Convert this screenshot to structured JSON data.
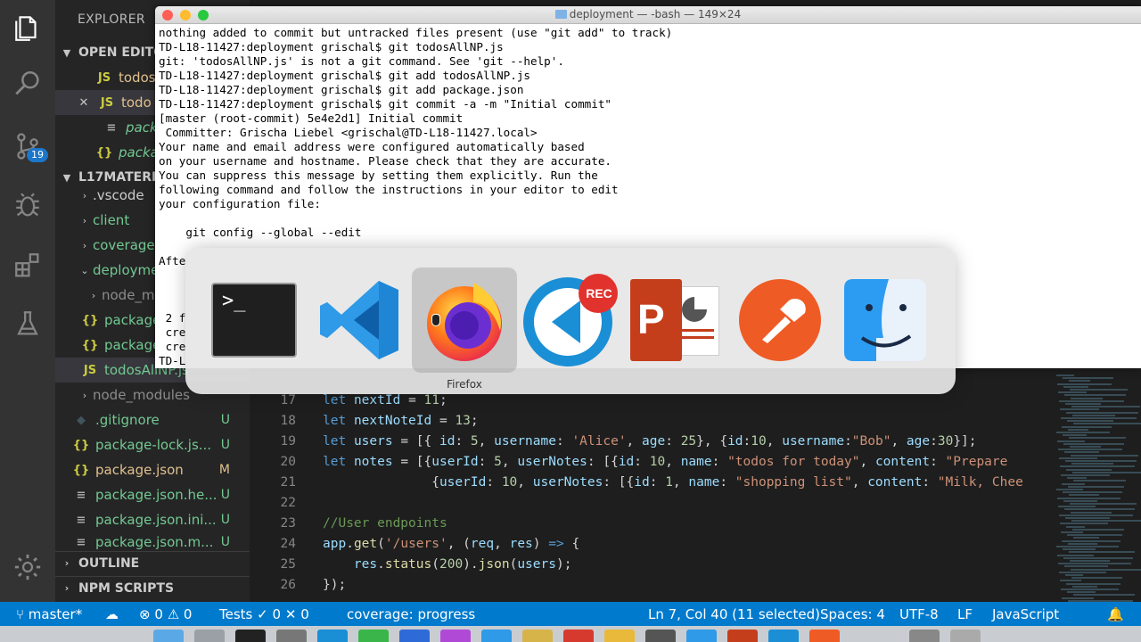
{
  "explorer": {
    "title": "EXPLORER",
    "open_editors_label": "OPEN EDITO",
    "open_editors": [
      {
        "icon": "JS",
        "label": "todos"
      },
      {
        "icon": "JS",
        "label": "todo"
      },
      {
        "icon": "≡",
        "label": "packa"
      },
      {
        "icon": "{}",
        "label": "packa"
      }
    ],
    "close_glyph": "✕",
    "folder_label": "L17MATERIA",
    "tree": [
      {
        "label": ".vscode",
        "status": ""
      },
      {
        "label": "client",
        "status": ""
      },
      {
        "label": "coverage",
        "status": ""
      },
      {
        "label": "deployme",
        "status": ""
      },
      {
        "label": "node_m",
        "status": ""
      },
      {
        "label": "package",
        "status": ""
      },
      {
        "label": "package",
        "status": ""
      },
      {
        "label": "todosAllNP.js",
        "status": ""
      },
      {
        "label": "node_modules",
        "status": ""
      },
      {
        "label": ".gitignore",
        "status": "U"
      },
      {
        "label": "package-lock.js...",
        "status": "U"
      },
      {
        "label": "package.json",
        "status": "M"
      },
      {
        "label": "package.json.he...",
        "status": "U"
      },
      {
        "label": "package.json.ini...",
        "status": "U"
      },
      {
        "label": "package.json.m...",
        "status": "U"
      }
    ],
    "outline_label": "OUTLINE",
    "npm_scripts_label": "NPM SCRIPTS"
  },
  "activity": {
    "badge": "19",
    "icons": [
      "files-icon",
      "search-icon",
      "source-control-icon",
      "debug-icon",
      "extensions-icon",
      "test-flask-icon",
      "settings-gear-icon"
    ]
  },
  "terminal": {
    "title": "deployment — -bash — 149×24",
    "lines": [
      "nothing added to commit but untracked files present (use \"git add\" to track)",
      "TD-L18-11427:deployment grischal$ git todosAllNP.js",
      "git: 'todosAllNP.js' is not a git command. See 'git --help'.",
      "TD-L18-11427:deployment grischal$ git add todosAllNP.js",
      "TD-L18-11427:deployment grischal$ git add package.json",
      "TD-L18-11427:deployment grischal$ git commit -a -m \"Initial commit\"",
      "[master (root-commit) 5e4e2d1] Initial commit",
      " Committer: Grischa Liebel <grischal@TD-L18-11427.local>",
      "Your name and email address were configured automatically based",
      "on your username and hostname. Please check that they are accurate.",
      "You can suppress this message by setting them explicitly. Run the",
      "following command and follow the instructions in your editor to edit",
      "your configuration file:",
      "",
      "    git config --global --edit",
      "",
      "Afte",
      "",
      "",
      "",
      " 2 f",
      " cre",
      " cre",
      "TD-L"
    ]
  },
  "switcher": {
    "apps": [
      {
        "name": "Terminal",
        "icon": "terminal-icon",
        "prompt": ">_"
      },
      {
        "name": "Visual Studio Code",
        "icon": "vscode-icon"
      },
      {
        "name": "Firefox",
        "icon": "firefox-icon"
      },
      {
        "name": "Screen Recorder",
        "icon": "recorder-icon",
        "badge": "REC"
      },
      {
        "name": "PowerPoint",
        "icon": "powerpoint-icon",
        "letter": "P"
      },
      {
        "name": "Postman",
        "icon": "postman-icon"
      },
      {
        "name": "Finder",
        "icon": "finder-icon"
      }
    ],
    "selected_label": "Firefox"
  },
  "editor": {
    "lines": [
      {
        "n": "17"
      },
      {
        "n": "18"
      },
      {
        "n": "19"
      },
      {
        "n": "20"
      },
      {
        "n": "21"
      },
      {
        "n": "22"
      },
      {
        "n": "23"
      },
      {
        "n": "24"
      },
      {
        "n": "25"
      },
      {
        "n": "26"
      }
    ]
  },
  "statusbar": {
    "branch": "master*",
    "errors": "0",
    "warnings": "0",
    "tests_label": "Tests",
    "tests_passed": "0",
    "tests_failed": "0",
    "coverage": "coverage: progress",
    "position": "Ln 7, Col 40 (11 selected)",
    "spaces": "Spaces: 4",
    "encoding": "UTF-8",
    "eol": "LF",
    "language": "JavaScript"
  },
  "colors": {
    "statusbar": "#007acc",
    "activity": "#333333",
    "sidebar": "#252526",
    "editor": "#1e1e1e"
  }
}
